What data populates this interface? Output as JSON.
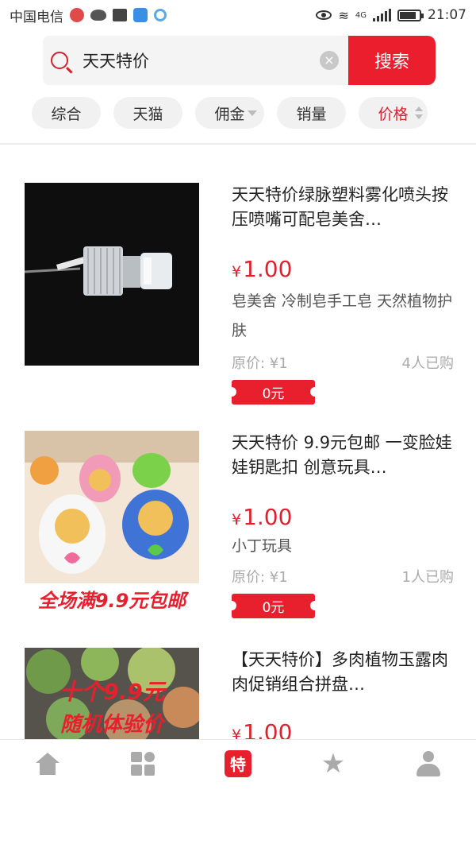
{
  "status_bar": {
    "carrier": "中国电信",
    "network": "4G",
    "time": "21:07"
  },
  "search": {
    "query": "天天特价",
    "button_label": "搜索"
  },
  "filters": [
    {
      "label": "综合"
    },
    {
      "label": "天猫"
    },
    {
      "label": "佣金"
    },
    {
      "label": "销量"
    },
    {
      "label": "价格"
    }
  ],
  "products": [
    {
      "title": "天天特价绿脉塑料雾化喷头按压喷嘴可配皂美舍…",
      "price_symbol": "¥",
      "price": "1.00",
      "description": "皂美舍 冷制皂手工皂 天然植物护肤",
      "original_price": "原价: ¥1",
      "sold": "4人已购",
      "coupon": "0元"
    },
    {
      "title": "天天特价 9.9元包邮 一变脸娃娃钥匙扣 创意玩具…",
      "price_symbol": "¥",
      "price": "1.00",
      "description": "小丁玩具",
      "original_price": "原价: ¥1",
      "sold": "1人已购",
      "coupon": "0元",
      "image_banner": "全场满9.9元包邮"
    },
    {
      "title": "【天天特价】多肉植物玉露肉肉促销组合拼盘…",
      "price_symbol": "¥",
      "price": "1.00",
      "image_banner_1": "十个9.9元",
      "image_banner_2": "随机体验价"
    }
  ],
  "tab_bar": {
    "special_label": "特"
  },
  "colors": {
    "accent": "#ea1e2d",
    "price": "#e0202e",
    "muted": "#aaaaaa"
  }
}
